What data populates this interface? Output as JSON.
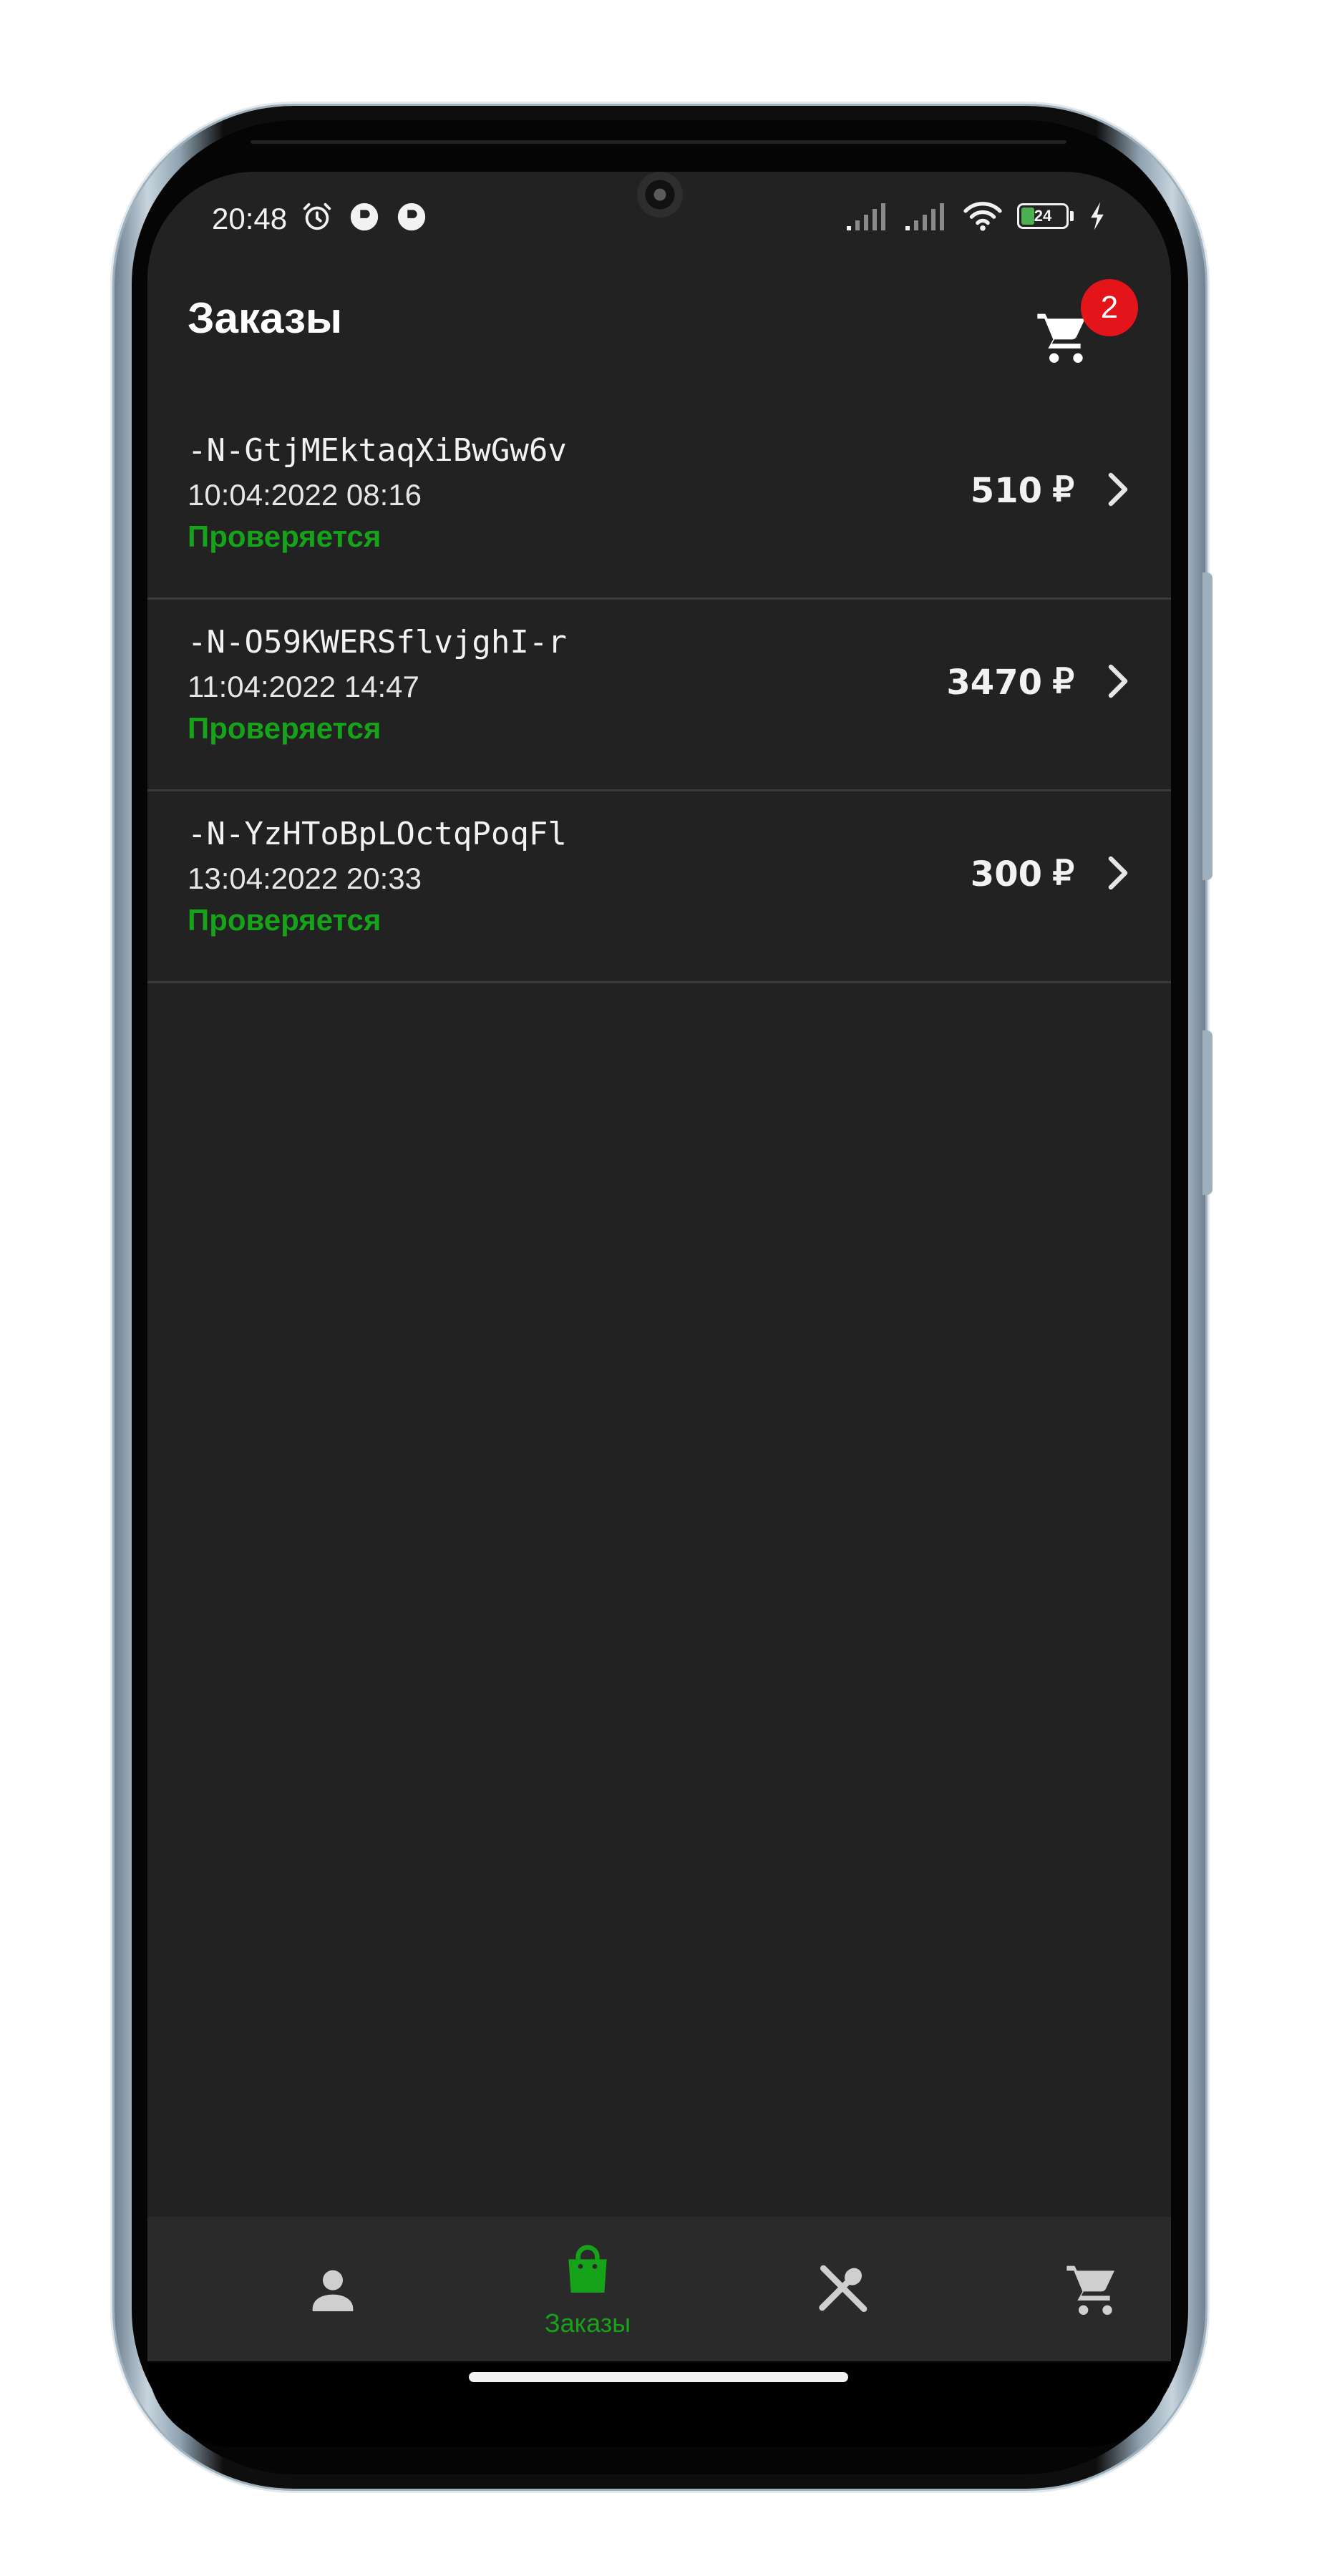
{
  "status_bar": {
    "time": "20:48",
    "battery": "24"
  },
  "app_bar": {
    "title": "Заказы",
    "cart_badge": "2"
  },
  "orders": [
    {
      "id": "-N-GtjMEktaqXiBwGw6v",
      "date": "10:04:2022 08:16",
      "status": "Проверяется",
      "price": "510",
      "currency": "₽"
    },
    {
      "id": "-N-O59KWERSflvjghI-r",
      "date": "11:04:2022 14:47",
      "status": "Проверяется",
      "price": "3470",
      "currency": "₽"
    },
    {
      "id": "-N-YzHToBpLOctqPoqFl",
      "date": "13:04:2022 20:33",
      "status": "Проверяется",
      "price": "300",
      "currency": "₽"
    }
  ],
  "bottom_nav": {
    "items": [
      {
        "icon": "person-icon",
        "label": "",
        "active": false
      },
      {
        "icon": "shopping-bag-icon",
        "label": "Заказы",
        "active": true
      },
      {
        "icon": "utensils-icon",
        "label": "",
        "active": false
      },
      {
        "icon": "cart-icon",
        "label": "",
        "active": false
      }
    ]
  },
  "colors": {
    "background": "#222222",
    "accent_green": "#16a31a",
    "badge_red": "#e3141a",
    "nav_background": "#2a2a2a",
    "inactive_icon": "#cfcfcf"
  }
}
